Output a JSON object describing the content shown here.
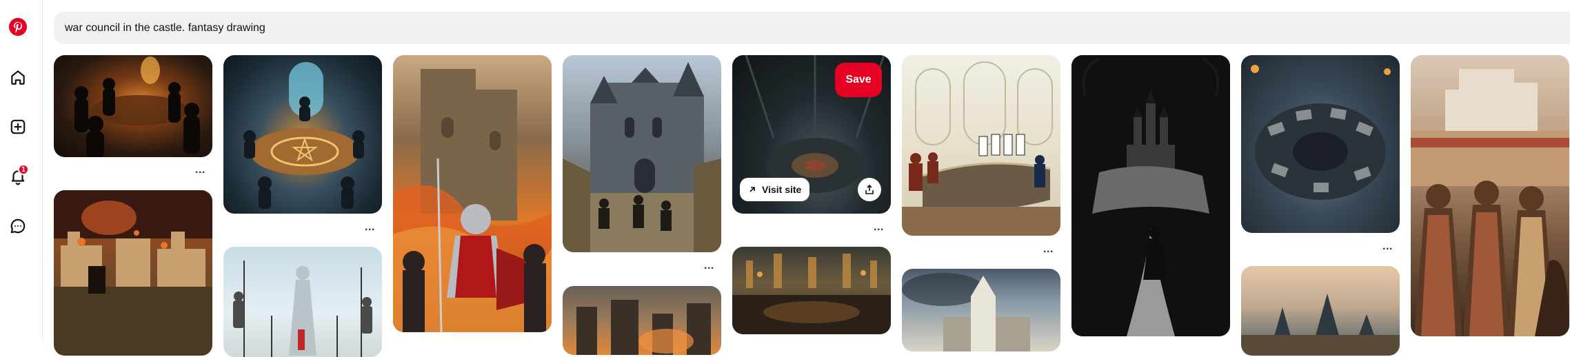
{
  "search": {
    "query": "war council in the castle. fantasy drawing"
  },
  "sidebar": {
    "items": [
      {
        "icon": "pinterest-logo-icon"
      },
      {
        "icon": "home-icon"
      },
      {
        "icon": "create-icon"
      },
      {
        "icon": "notifications-icon",
        "badge": "1"
      },
      {
        "icon": "messages-icon"
      }
    ]
  },
  "pins": [
    {
      "description": "dark council chamber around a fire table",
      "menu": "..."
    },
    {
      "description": "burning walled city under siege"
    },
    {
      "description": "mages around a glowing pentagram table",
      "menu": "..."
    },
    {
      "description": "white statue of a woman between spears"
    },
    {
      "description": "knight in red and silver armor before a burning castle"
    },
    {
      "description": "grey gothic castle with knights riding out",
      "menu": "..."
    },
    {
      "description": "smoky ruined city skyline"
    },
    {
      "description": "round war table in dark stone hall",
      "menu": "..."
    },
    {
      "description": "ornate council hall"
    },
    {
      "description": "white palace council room with long table",
      "menu": "..."
    },
    {
      "description": "castle tower against cloudy sky"
    },
    {
      "description": "black and white drawing of a wanderer approaching a castle"
    },
    {
      "description": "round war table with maps seen from above",
      "menu": "..."
    },
    {
      "description": "tents before a fortress"
    },
    {
      "description": "ladies in gowns watching a castle courtyard"
    }
  ],
  "hover_actions": {
    "save": "Save",
    "visit": "Visit site"
  },
  "colors": {
    "brand": "#e60023",
    "search_bg": "#f1f1f1"
  }
}
